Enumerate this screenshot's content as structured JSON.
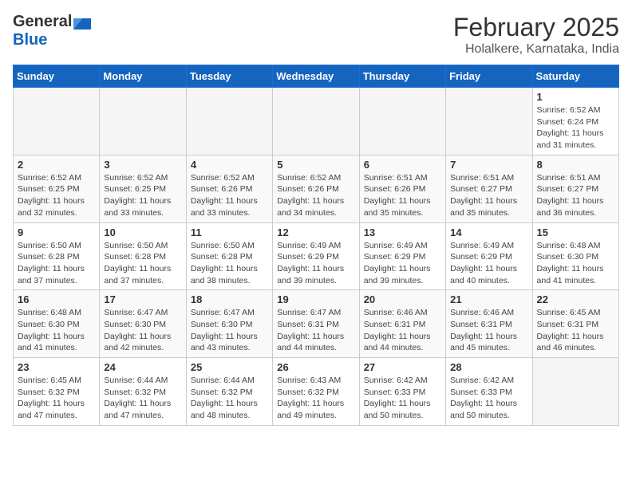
{
  "header": {
    "logo_line1": "General",
    "logo_line2": "Blue",
    "month_title": "February 2025",
    "location": "Holalkere, Karnataka, India"
  },
  "days_of_week": [
    "Sunday",
    "Monday",
    "Tuesday",
    "Wednesday",
    "Thursday",
    "Friday",
    "Saturday"
  ],
  "weeks": [
    [
      {
        "day": "",
        "info": ""
      },
      {
        "day": "",
        "info": ""
      },
      {
        "day": "",
        "info": ""
      },
      {
        "day": "",
        "info": ""
      },
      {
        "day": "",
        "info": ""
      },
      {
        "day": "",
        "info": ""
      },
      {
        "day": "1",
        "info": "Sunrise: 6:52 AM\nSunset: 6:24 PM\nDaylight: 11 hours\nand 31 minutes."
      }
    ],
    [
      {
        "day": "2",
        "info": "Sunrise: 6:52 AM\nSunset: 6:25 PM\nDaylight: 11 hours\nand 32 minutes."
      },
      {
        "day": "3",
        "info": "Sunrise: 6:52 AM\nSunset: 6:25 PM\nDaylight: 11 hours\nand 33 minutes."
      },
      {
        "day": "4",
        "info": "Sunrise: 6:52 AM\nSunset: 6:26 PM\nDaylight: 11 hours\nand 33 minutes."
      },
      {
        "day": "5",
        "info": "Sunrise: 6:52 AM\nSunset: 6:26 PM\nDaylight: 11 hours\nand 34 minutes."
      },
      {
        "day": "6",
        "info": "Sunrise: 6:51 AM\nSunset: 6:26 PM\nDaylight: 11 hours\nand 35 minutes."
      },
      {
        "day": "7",
        "info": "Sunrise: 6:51 AM\nSunset: 6:27 PM\nDaylight: 11 hours\nand 35 minutes."
      },
      {
        "day": "8",
        "info": "Sunrise: 6:51 AM\nSunset: 6:27 PM\nDaylight: 11 hours\nand 36 minutes."
      }
    ],
    [
      {
        "day": "9",
        "info": "Sunrise: 6:50 AM\nSunset: 6:28 PM\nDaylight: 11 hours\nand 37 minutes."
      },
      {
        "day": "10",
        "info": "Sunrise: 6:50 AM\nSunset: 6:28 PM\nDaylight: 11 hours\nand 37 minutes."
      },
      {
        "day": "11",
        "info": "Sunrise: 6:50 AM\nSunset: 6:28 PM\nDaylight: 11 hours\nand 38 minutes."
      },
      {
        "day": "12",
        "info": "Sunrise: 6:49 AM\nSunset: 6:29 PM\nDaylight: 11 hours\nand 39 minutes."
      },
      {
        "day": "13",
        "info": "Sunrise: 6:49 AM\nSunset: 6:29 PM\nDaylight: 11 hours\nand 39 minutes."
      },
      {
        "day": "14",
        "info": "Sunrise: 6:49 AM\nSunset: 6:29 PM\nDaylight: 11 hours\nand 40 minutes."
      },
      {
        "day": "15",
        "info": "Sunrise: 6:48 AM\nSunset: 6:30 PM\nDaylight: 11 hours\nand 41 minutes."
      }
    ],
    [
      {
        "day": "16",
        "info": "Sunrise: 6:48 AM\nSunset: 6:30 PM\nDaylight: 11 hours\nand 41 minutes."
      },
      {
        "day": "17",
        "info": "Sunrise: 6:47 AM\nSunset: 6:30 PM\nDaylight: 11 hours\nand 42 minutes."
      },
      {
        "day": "18",
        "info": "Sunrise: 6:47 AM\nSunset: 6:30 PM\nDaylight: 11 hours\nand 43 minutes."
      },
      {
        "day": "19",
        "info": "Sunrise: 6:47 AM\nSunset: 6:31 PM\nDaylight: 11 hours\nand 44 minutes."
      },
      {
        "day": "20",
        "info": "Sunrise: 6:46 AM\nSunset: 6:31 PM\nDaylight: 11 hours\nand 44 minutes."
      },
      {
        "day": "21",
        "info": "Sunrise: 6:46 AM\nSunset: 6:31 PM\nDaylight: 11 hours\nand 45 minutes."
      },
      {
        "day": "22",
        "info": "Sunrise: 6:45 AM\nSunset: 6:31 PM\nDaylight: 11 hours\nand 46 minutes."
      }
    ],
    [
      {
        "day": "23",
        "info": "Sunrise: 6:45 AM\nSunset: 6:32 PM\nDaylight: 11 hours\nand 47 minutes."
      },
      {
        "day": "24",
        "info": "Sunrise: 6:44 AM\nSunset: 6:32 PM\nDaylight: 11 hours\nand 47 minutes."
      },
      {
        "day": "25",
        "info": "Sunrise: 6:44 AM\nSunset: 6:32 PM\nDaylight: 11 hours\nand 48 minutes."
      },
      {
        "day": "26",
        "info": "Sunrise: 6:43 AM\nSunset: 6:32 PM\nDaylight: 11 hours\nand 49 minutes."
      },
      {
        "day": "27",
        "info": "Sunrise: 6:42 AM\nSunset: 6:33 PM\nDaylight: 11 hours\nand 50 minutes."
      },
      {
        "day": "28",
        "info": "Sunrise: 6:42 AM\nSunset: 6:33 PM\nDaylight: 11 hours\nand 50 minutes."
      },
      {
        "day": "",
        "info": ""
      }
    ]
  ]
}
